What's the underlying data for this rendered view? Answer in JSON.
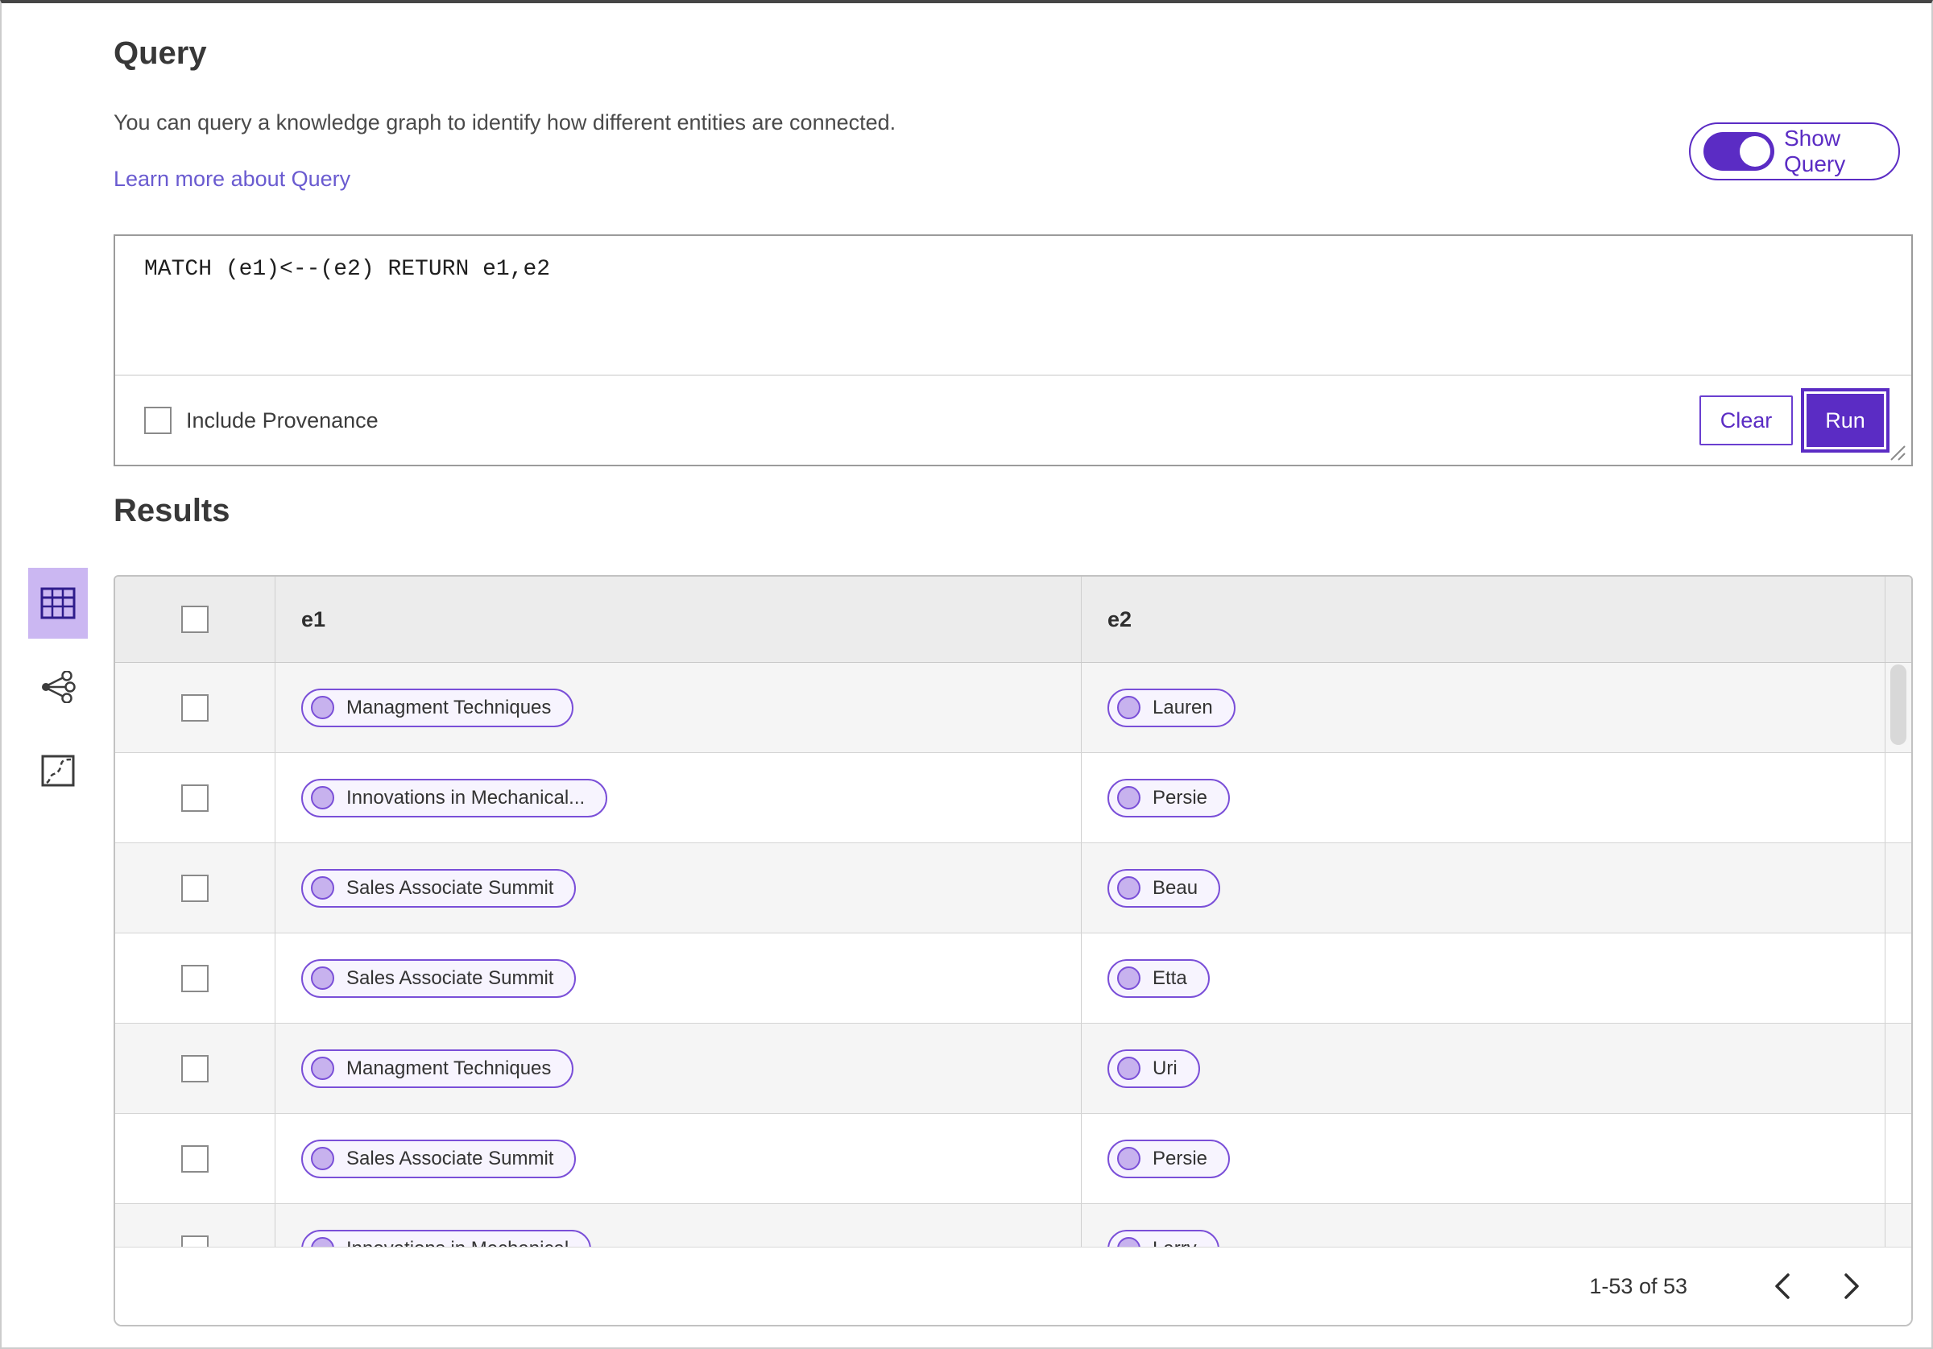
{
  "query_section": {
    "title": "Query",
    "description": "You can query a knowledge graph to identify how different entities are connected.",
    "learn_more_label": "Learn more about Query",
    "show_query_label": "Show Query",
    "show_query_state": "on",
    "query_text": "MATCH (e1)<--(e2) RETURN e1,e2",
    "include_provenance_label": "Include Provenance",
    "include_provenance_checked": false,
    "clear_label": "Clear",
    "run_label": "Run"
  },
  "results_section": {
    "title": "Results",
    "view_switcher": {
      "selected": "table",
      "icons": [
        "table-view-icon",
        "graph-view-icon",
        "map-view-icon"
      ]
    },
    "table": {
      "columns": [
        "e1",
        "e2"
      ],
      "select_all_checked": false,
      "rows": [
        {
          "e1": "Managment Techniques",
          "e2": "Lauren"
        },
        {
          "e1": "Innovations in Mechanical...",
          "e2": "Persie"
        },
        {
          "e1": "Sales Associate Summit",
          "e2": "Beau"
        },
        {
          "e1": "Sales Associate Summit",
          "e2": "Etta"
        },
        {
          "e1": "Managment Techniques",
          "e2": "Uri"
        },
        {
          "e1": "Sales Associate Summit",
          "e2": "Persie"
        },
        {
          "e1": "Innovations in Mechanical",
          "e2": "Larry"
        }
      ]
    },
    "pagination": {
      "range_label": "1-53 of 53"
    }
  },
  "colors": {
    "accent_purple": "#5b2cc4",
    "pill_border": "#7a4fd8",
    "pill_background": "#f7f4fe",
    "pill_dot": "#c7b2ee",
    "link": "#6a5bd0",
    "selected_view_background": "#cbb7f2",
    "header_background": "#ececec",
    "odd_row_background": "#f5f5f5"
  }
}
